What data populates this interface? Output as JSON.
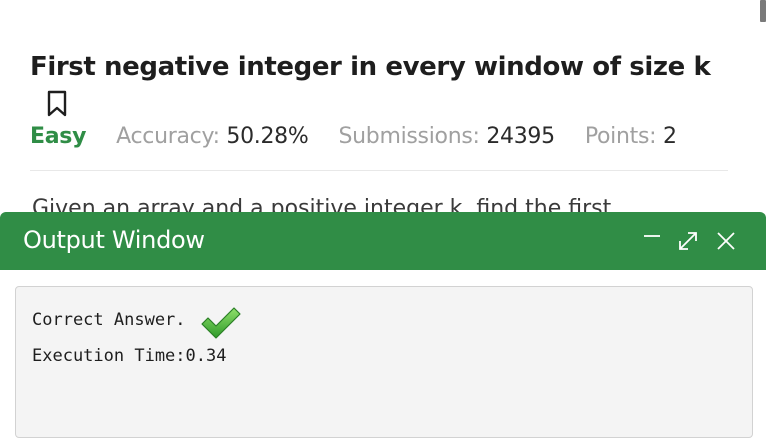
{
  "problem": {
    "title": "First negative integer in every window of size k",
    "bookmark_icon": "bookmark-icon",
    "difficulty": "Easy",
    "accuracy_label": "Accuracy:",
    "accuracy_value": "50.28%",
    "submissions_label": "Submissions:",
    "submissions_value": "24395",
    "points_label": "Points:",
    "points_value": "2",
    "description_partial": "Given an array and a positive integer k, find the first"
  },
  "output_window": {
    "title": "Output Window",
    "controls": [
      "minimize-icon",
      "maximize-icon",
      "close-icon"
    ],
    "result_text": "Correct Answer.",
    "result_icon": "checkmark-icon",
    "execution_time": "Execution Time:0.34"
  },
  "colors": {
    "brand_green": "#308d46",
    "difficulty_green": "#2f8d46",
    "muted_text": "#a0a0a0"
  }
}
